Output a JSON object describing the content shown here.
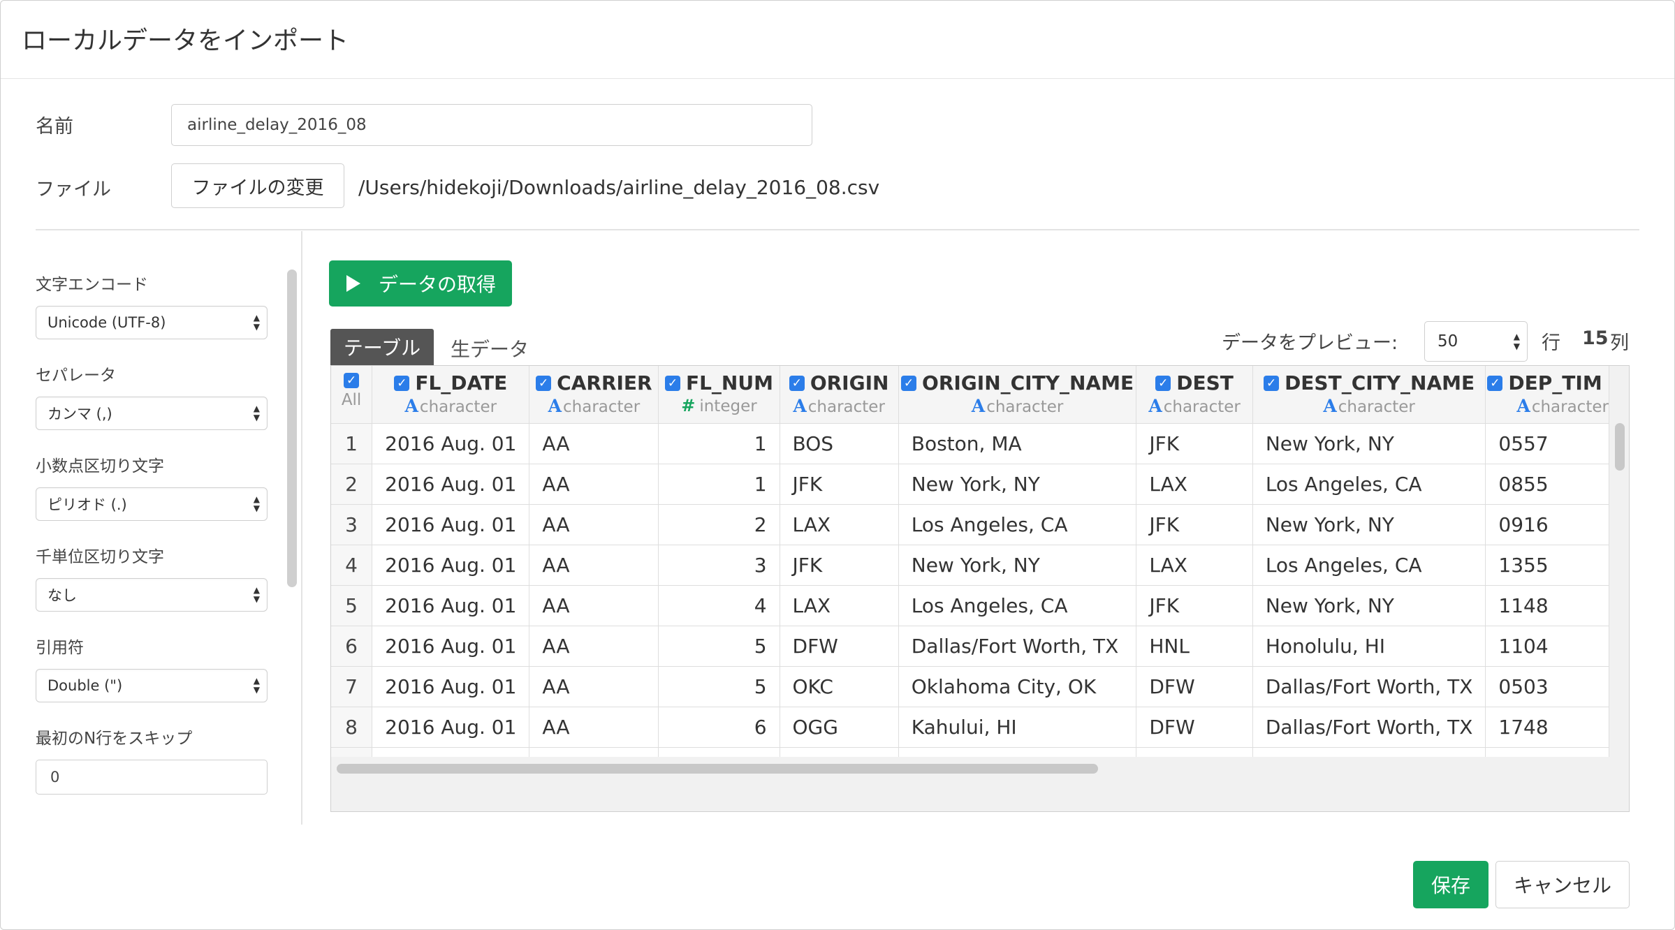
{
  "dialog": {
    "title": "ローカルデータをインポート",
    "name_label": "名前",
    "name_value": "airline_delay_2016_08",
    "file_label": "ファイル",
    "change_file_button": "ファイルの変更",
    "file_path": "/Users/hidekoji/Downloads/airline_delay_2016_08.csv"
  },
  "options": {
    "encoding_label": "文字エンコード",
    "encoding_value": "Unicode (UTF-8)",
    "separator_label": "セパレータ",
    "separator_value": "カンマ (,)",
    "decimal_label": "小数点区切り文字",
    "decimal_value": "ピリオド (.)",
    "thousands_label": "千単位区切り文字",
    "thousands_value": "なし",
    "quote_label": "引用符",
    "quote_value": "Double (\")",
    "skip_label": "最初のN行をスキップ",
    "skip_value": "0"
  },
  "toolbar": {
    "fetch_button": "データの取得",
    "tab_table": "テーブル",
    "tab_raw": "生データ",
    "preview_label": "データをプレビュー:",
    "preview_rows": "50",
    "rows_label": "行",
    "columns_count": "15",
    "columns_label": "列"
  },
  "grid": {
    "all_label": "All",
    "columns": [
      {
        "name": "FL_DATE",
        "type": "character"
      },
      {
        "name": "CARRIER",
        "type": "character"
      },
      {
        "name": "FL_NUM",
        "type": "integer"
      },
      {
        "name": "ORIGIN",
        "type": "character"
      },
      {
        "name": "ORIGIN_CITY_NAME",
        "type": "character"
      },
      {
        "name": "DEST",
        "type": "character"
      },
      {
        "name": "DEST_CITY_NAME",
        "type": "character"
      },
      {
        "name": "DEP_TIM",
        "type": "character"
      }
    ],
    "rows": [
      [
        "1",
        "2016 Aug. 01",
        "AA",
        "1",
        "BOS",
        "Boston, MA",
        "JFK",
        "New York, NY",
        "0557"
      ],
      [
        "2",
        "2016 Aug. 01",
        "AA",
        "1",
        "JFK",
        "New York, NY",
        "LAX",
        "Los Angeles, CA",
        "0855"
      ],
      [
        "3",
        "2016 Aug. 01",
        "AA",
        "2",
        "LAX",
        "Los Angeles, CA",
        "JFK",
        "New York, NY",
        "0916"
      ],
      [
        "4",
        "2016 Aug. 01",
        "AA",
        "3",
        "JFK",
        "New York, NY",
        "LAX",
        "Los Angeles, CA",
        "1355"
      ],
      [
        "5",
        "2016 Aug. 01",
        "AA",
        "4",
        "LAX",
        "Los Angeles, CA",
        "JFK",
        "New York, NY",
        "1148"
      ],
      [
        "6",
        "2016 Aug. 01",
        "AA",
        "5",
        "DFW",
        "Dallas/Fort Worth, TX",
        "HNL",
        "Honolulu, HI",
        "1104"
      ],
      [
        "7",
        "2016 Aug. 01",
        "AA",
        "5",
        "OKC",
        "Oklahoma City, OK",
        "DFW",
        "Dallas/Fort Worth, TX",
        "0503"
      ],
      [
        "8",
        "2016 Aug. 01",
        "AA",
        "6",
        "OGG",
        "Kahului, HI",
        "DFW",
        "Dallas/Fort Worth, TX",
        "1748"
      ]
    ]
  },
  "footer": {
    "save_button": "保存",
    "cancel_button": "キャンセル"
  },
  "colors": {
    "accent_green": "#16a55e",
    "checkbox_blue": "#2b7de9"
  }
}
